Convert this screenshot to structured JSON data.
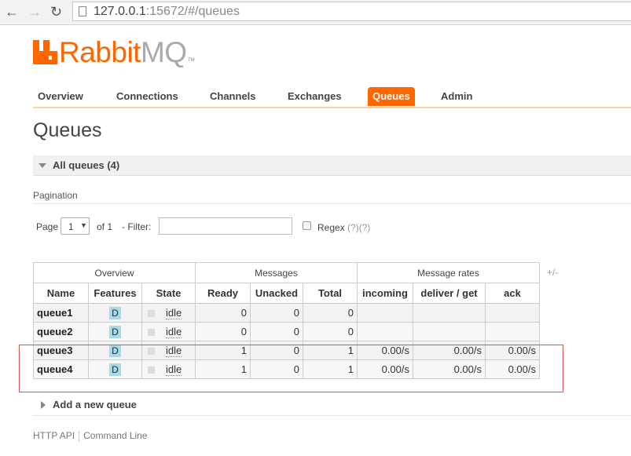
{
  "browser": {
    "url_host": "127.0.0.1",
    "url_rest": ":15672/#/queues"
  },
  "logo": {
    "rabbit": "Rabbit",
    "mq": "MQ",
    "tm": "TM"
  },
  "nav": {
    "tabs": [
      "Overview",
      "Connections",
      "Channels",
      "Exchanges",
      "Queues",
      "Admin"
    ],
    "active": "Queues"
  },
  "page": {
    "title": "Queues"
  },
  "all_queues": {
    "label": "All queues (4)"
  },
  "pagination": {
    "section_label": "Pagination",
    "page_label": "Page",
    "page_value": "1",
    "of_label": "of 1",
    "filter_label": "- Filter:",
    "filter_value": "",
    "regex_label": "Regex",
    "regex_help": "(?)(?)"
  },
  "table": {
    "groups": [
      "Overview",
      "Messages",
      "Message rates"
    ],
    "columns": [
      "Name",
      "Features",
      "State",
      "Ready",
      "Unacked",
      "Total",
      "incoming",
      "deliver / get",
      "ack"
    ],
    "toggle": "+/-",
    "rows": [
      {
        "name": "queue1",
        "feature": "D",
        "state": "idle",
        "ready": "0",
        "unacked": "0",
        "total": "0",
        "incoming": "",
        "deliver_get": "",
        "ack": ""
      },
      {
        "name": "queue2",
        "feature": "D",
        "state": "idle",
        "ready": "0",
        "unacked": "0",
        "total": "0",
        "incoming": "",
        "deliver_get": "",
        "ack": ""
      },
      {
        "name": "queue3",
        "feature": "D",
        "state": "idle",
        "ready": "1",
        "unacked": "0",
        "total": "1",
        "incoming": "0.00/s",
        "deliver_get": "0.00/s",
        "ack": "0.00/s"
      },
      {
        "name": "queue4",
        "feature": "D",
        "state": "idle",
        "ready": "1",
        "unacked": "0",
        "total": "1",
        "incoming": "0.00/s",
        "deliver_get": "0.00/s",
        "ack": "0.00/s"
      }
    ]
  },
  "add_queue": {
    "label": "Add a new queue"
  },
  "footer": {
    "links": [
      "HTTP API",
      "Command Line"
    ]
  },
  "colors": {
    "brand": "#ff6600",
    "feature_badge": "#a8dadf",
    "highlight_box": "#d9534f"
  }
}
